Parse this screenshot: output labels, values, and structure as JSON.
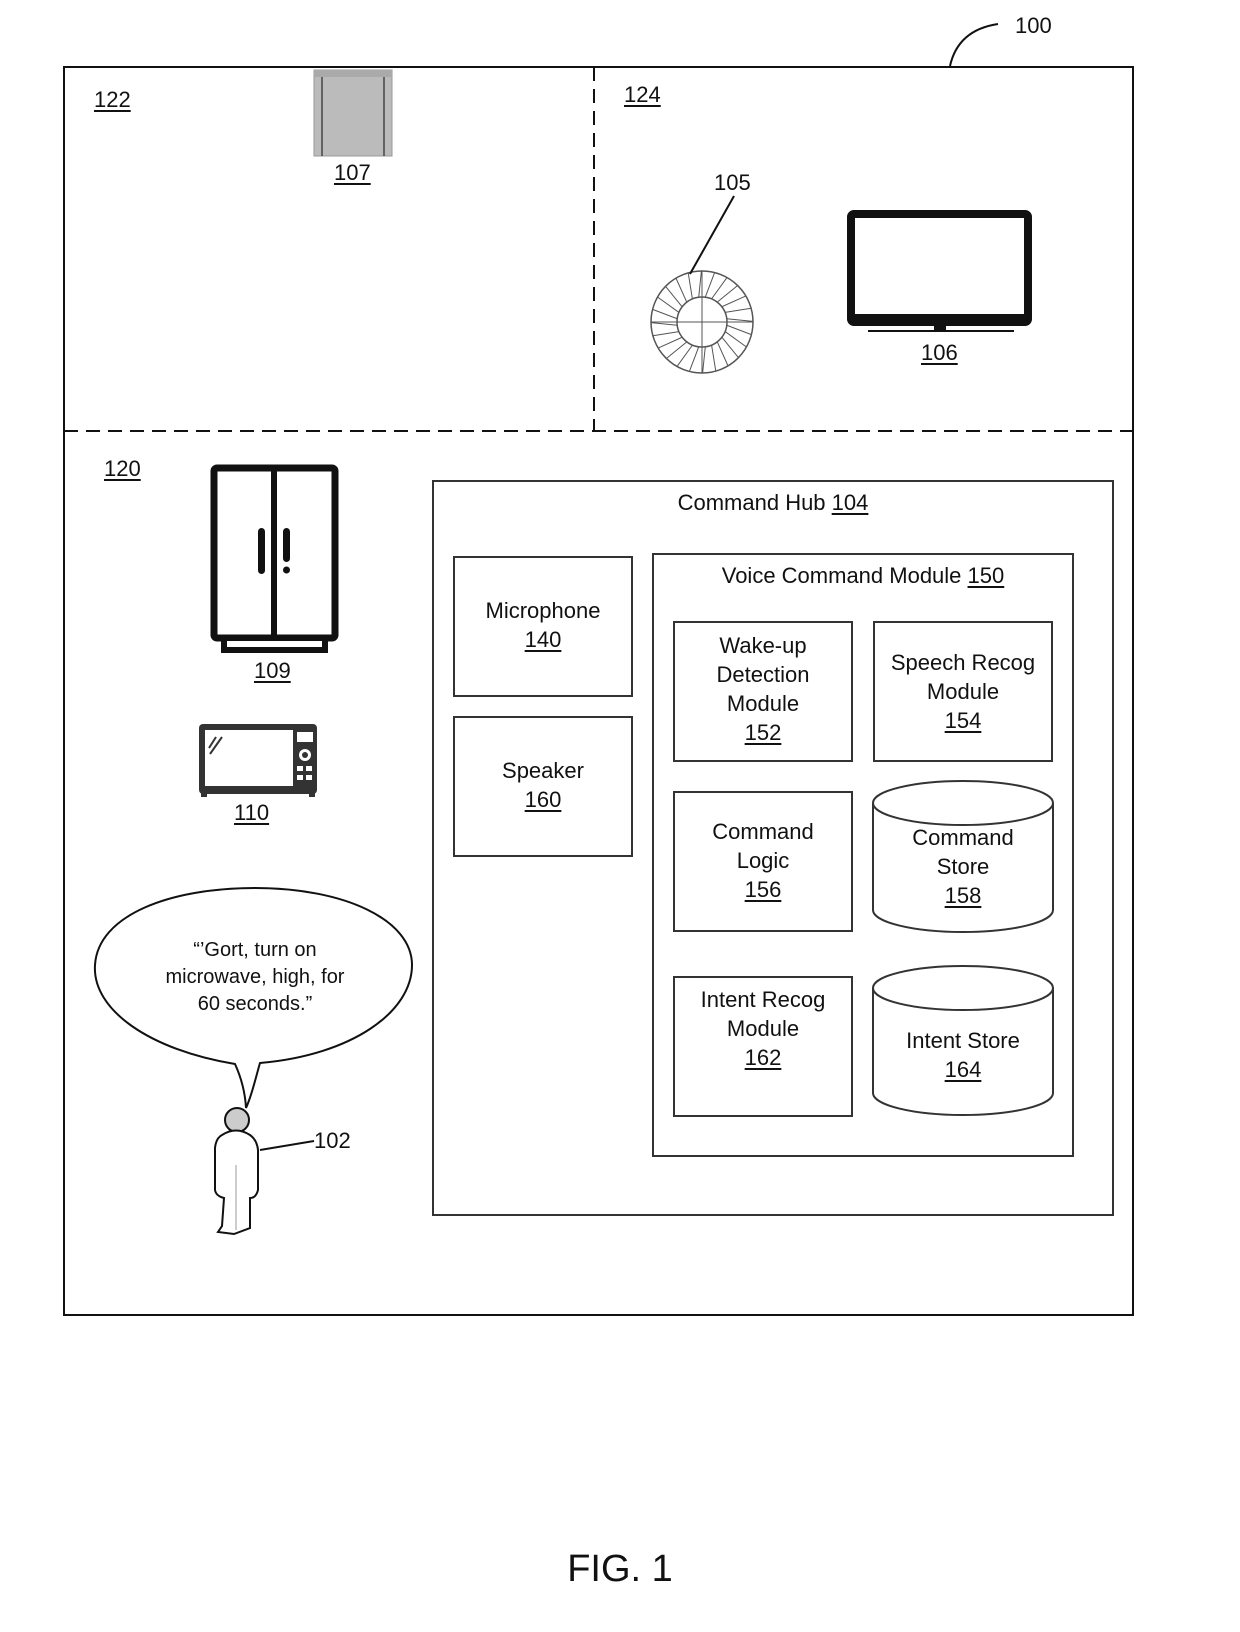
{
  "figure": {
    "ref": "100",
    "caption": "FIG. 1"
  },
  "rooms": {
    "room_122": {
      "ref": "122"
    },
    "room_124": {
      "ref": "124"
    },
    "room_120": {
      "ref": "120"
    }
  },
  "devices": {
    "thermostat_window": {
      "ref": "107",
      "icon": "window-blind-icon"
    },
    "smart_light": {
      "ref": "105",
      "icon": "light-fixture-icon"
    },
    "television": {
      "ref": "106",
      "icon": "television-icon"
    },
    "refrigerator": {
      "ref": "109",
      "icon": "refrigerator-icon"
    },
    "microwave": {
      "ref": "110",
      "icon": "microwave-icon"
    }
  },
  "user": {
    "ref": "102",
    "icon": "person-icon",
    "speech": [
      "“’Gort, turn on",
      "microwave, high, for",
      "60 seconds.”"
    ]
  },
  "command_hub": {
    "title": "Command Hub",
    "ref": "104",
    "microphone": {
      "title": "Microphone",
      "ref": "140"
    },
    "speaker": {
      "title": "Speaker",
      "ref": "160"
    },
    "voice_command_module": {
      "title": "Voice Command Module",
      "ref": "150",
      "wake_up": {
        "lines": [
          "Wake-up",
          "Detection",
          "Module"
        ],
        "ref": "152"
      },
      "speech_recog": {
        "lines": [
          "Speech Recog",
          "Module"
        ],
        "ref": "154"
      },
      "command_logic": {
        "lines": [
          "Command",
          "Logic"
        ],
        "ref": "156"
      },
      "command_store": {
        "lines": [
          "Command",
          "Store"
        ],
        "ref": "158"
      },
      "intent_recog": {
        "lines": [
          "Intent Recog",
          "Module"
        ],
        "ref": "162"
      },
      "intent_store": {
        "lines": [
          "Intent Store"
        ],
        "ref": "164"
      }
    }
  }
}
